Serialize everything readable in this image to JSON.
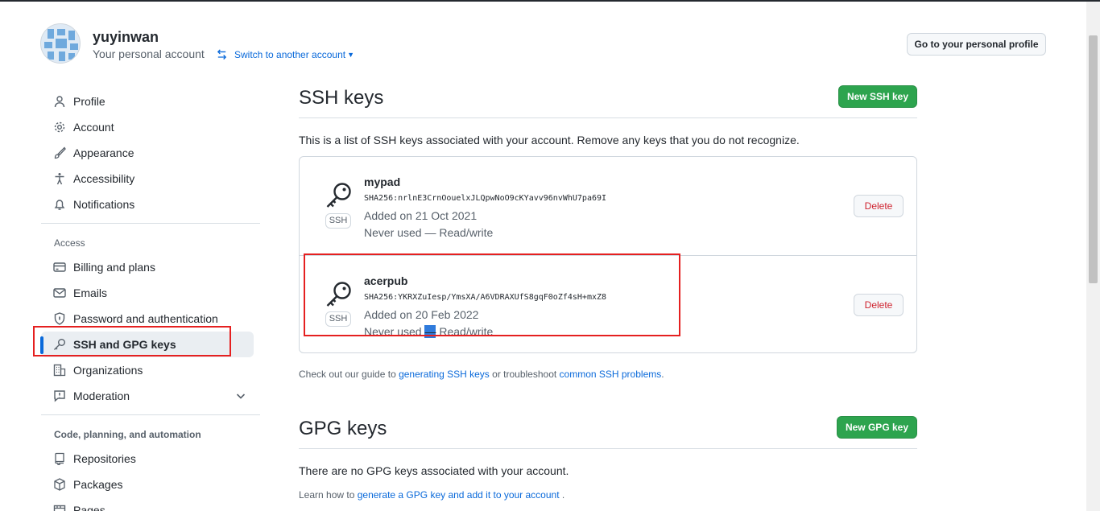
{
  "header": {
    "username": "yuyinwan",
    "subtitle": "Your personal account",
    "switch_label": "Switch to another account",
    "profile_button": "Go to your personal profile"
  },
  "sidebar": {
    "items": [
      {
        "label": "Profile",
        "icon": "person-icon"
      },
      {
        "label": "Account",
        "icon": "gear-icon"
      },
      {
        "label": "Appearance",
        "icon": "paintbrush-icon"
      },
      {
        "label": "Accessibility",
        "icon": "accessibility-icon"
      },
      {
        "label": "Notifications",
        "icon": "bell-icon"
      }
    ],
    "access_heading": "Access",
    "access_items": [
      {
        "label": "Billing and plans",
        "icon": "credit-card-icon"
      },
      {
        "label": "Emails",
        "icon": "mail-icon"
      },
      {
        "label": "Password and authentication",
        "icon": "shield-lock-icon"
      },
      {
        "label": "SSH and GPG keys",
        "icon": "key-icon",
        "selected": true
      },
      {
        "label": "Organizations",
        "icon": "organization-icon"
      },
      {
        "label": "Moderation",
        "icon": "report-icon"
      }
    ],
    "code_heading": "Code, planning, and automation",
    "code_items": [
      {
        "label": "Repositories",
        "icon": "repo-icon"
      },
      {
        "label": "Packages",
        "icon": "package-icon"
      },
      {
        "label": "Pages",
        "icon": "browser-icon"
      }
    ]
  },
  "ssh": {
    "heading": "SSH keys",
    "new_button": "New SSH key",
    "description": "This is a list of SSH keys associated with your account. Remove any keys that you do not recognize.",
    "badge": "SSH",
    "delete_label": "Delete",
    "keys": [
      {
        "title": "mypad",
        "fingerprint": "SHA256:nrlnE3CrnOouelxJLQpwNoO9cKYavv96nvWhU7pa69I",
        "added": "Added on 21 Oct 2021",
        "usage": "Never used — Read/write"
      },
      {
        "title": "acerpub",
        "fingerprint": "SHA256:YKRXZuIesp/YmsXA/A6VDRAXUfS8gqF0oZf4sH+mxZ8",
        "added": "Added on 20 Feb 2022",
        "usage_before": "Never used ",
        "usage_selected": "—",
        "usage_after": " Read/write"
      }
    ],
    "guide_text_1": "Check out our guide to ",
    "guide_link_1": "generating SSH keys",
    "guide_text_2": " or troubleshoot ",
    "guide_link_2": "common SSH problems",
    "guide_text_3": "."
  },
  "gpg": {
    "heading": "GPG keys",
    "new_button": "New GPG key",
    "empty_text": "There are no GPG keys associated with your account.",
    "learn_text_1": "Learn how to ",
    "learn_link": "generate a GPG key and add it to your account",
    "learn_text_2": " ."
  },
  "colors": {
    "accent": "#0969da",
    "green_button": "#2da44e",
    "danger": "#cf222e",
    "annotation_red": "#e52020"
  }
}
